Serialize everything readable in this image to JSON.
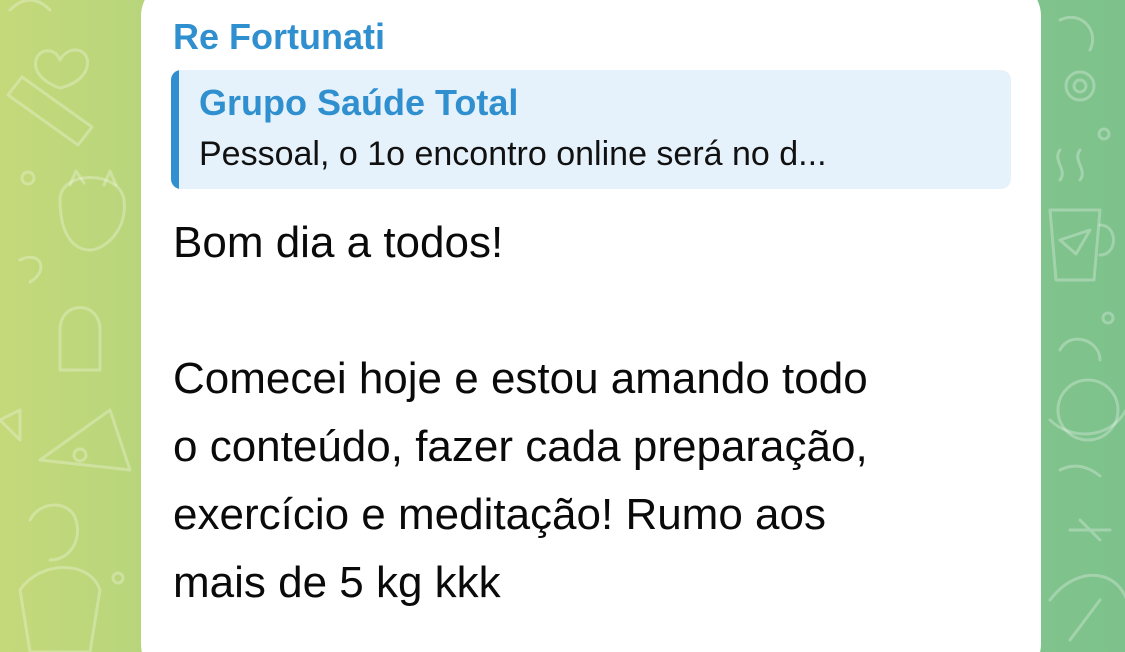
{
  "chat": {
    "background_colors": [
      "#c4d97a",
      "#7dc18c"
    ],
    "message": {
      "sender_name": "Re Fortunati",
      "sender_color": "#2f8fcf",
      "reply": {
        "title": "Grupo Saúde Total",
        "preview": "Pessoal, o 1o encontro online será no d..."
      },
      "lines": [
        "Bom dia a todos!",
        "",
        "Comecei hoje e estou amando todo",
        "o conteúdo, fazer cada preparação,",
        "exercício e meditação! Rumo aos",
        "mais de 5 kg kkk"
      ]
    }
  }
}
